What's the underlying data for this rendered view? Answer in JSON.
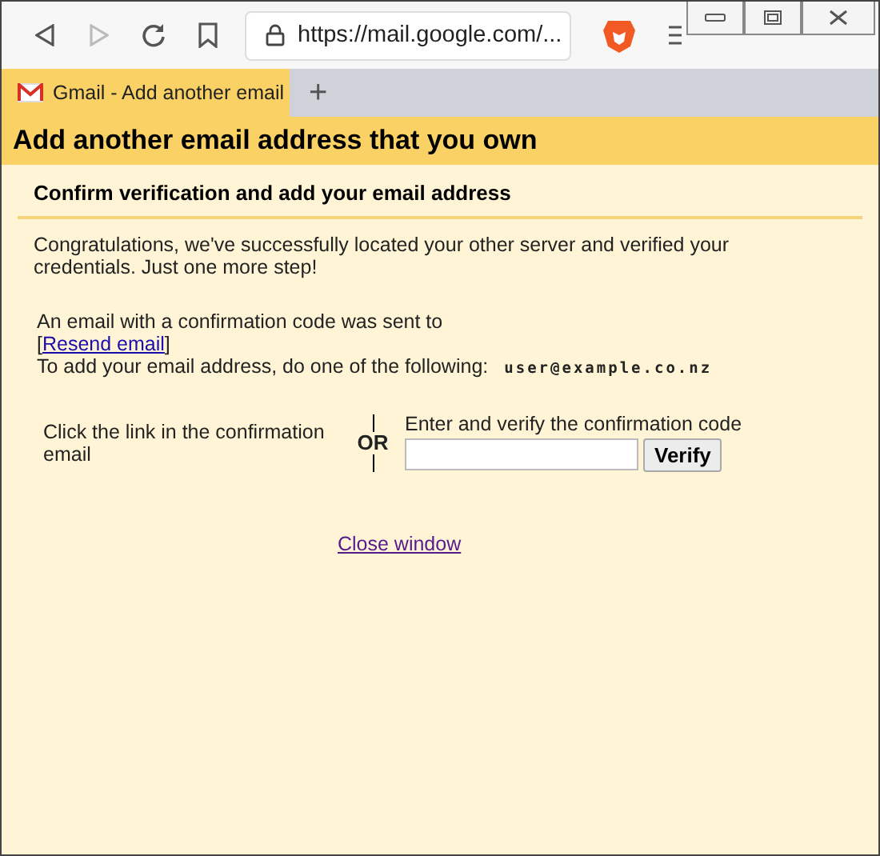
{
  "browser": {
    "url": "https://mail.google.com/...",
    "tabs": [
      {
        "title": "Gmail - Add another email",
        "selected": true
      }
    ],
    "new_tab": "+"
  },
  "page": {
    "title": "Add another email address that you own",
    "subtitle": "Confirm verification and add your email address",
    "intro": "Congratulations, we've successfully located your other server and verified your credentials. Just one more step!",
    "sent_text": "An email with a confirmation code was sent to",
    "resend_link": "Resend email",
    "bracket_open": "[",
    "bracket_close": "]",
    "instruction": "To add your email address, do one of the following:",
    "email": "user@example.co.nz",
    "option_link": "Click the link in the confirmation email",
    "or": "OR",
    "option_code": "Enter and verify the confirmation code",
    "verify_button": "Verify",
    "close_link": "Close window"
  }
}
